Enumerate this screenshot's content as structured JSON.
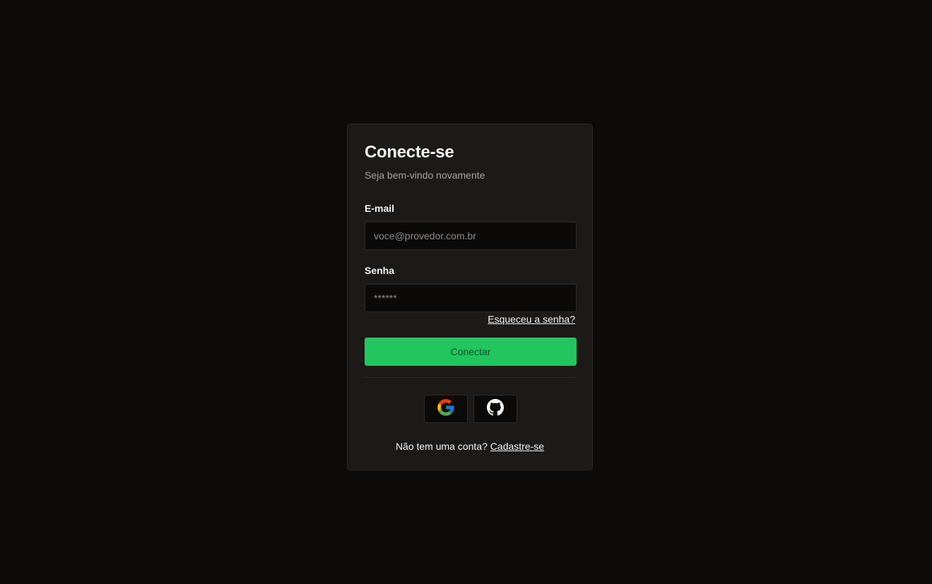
{
  "login": {
    "title": "Conecte-se",
    "subtitle": "Seja bem-vindo novamente",
    "email": {
      "label": "E-mail",
      "placeholder": "voce@provedor.com.br",
      "value": ""
    },
    "password": {
      "label": "Senha",
      "placeholder": "******",
      "value": ""
    },
    "forgot_link": "Esqueceu a senha?",
    "submit_label": "Conectar",
    "social": [
      {
        "name": "google",
        "icon": "google-icon"
      },
      {
        "name": "github",
        "icon": "github-icon"
      }
    ],
    "footer": {
      "text": "Não tem uma conta?",
      "link": "Cadastre-se"
    }
  },
  "colors": {
    "background": "#0c0b0a",
    "card": "#1c1917",
    "accent": "#22c55e",
    "accent_text": "#14532d"
  }
}
